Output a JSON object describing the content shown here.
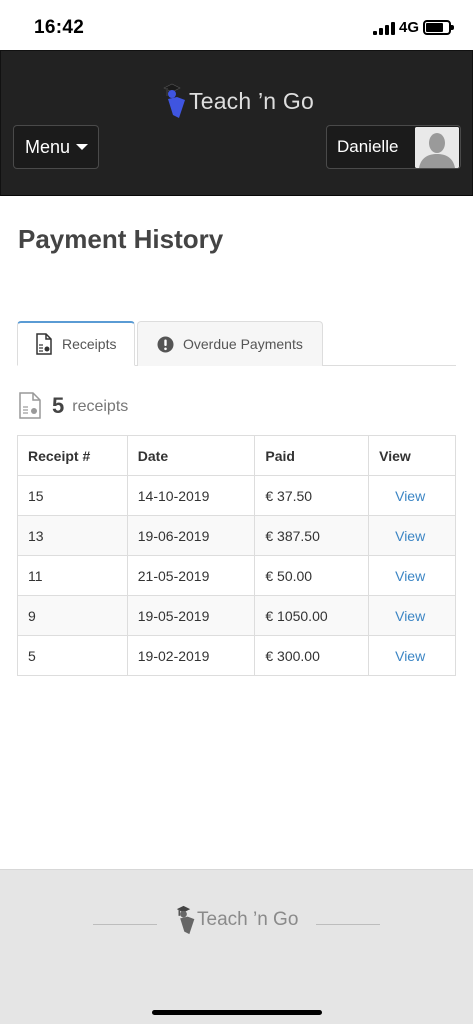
{
  "status_bar": {
    "time": "16:42",
    "network": "4G"
  },
  "header": {
    "app_name": "Teach ’n Go",
    "menu_label": "Menu",
    "user_name": "Danielle"
  },
  "page": {
    "title": "Payment History"
  },
  "tabs": [
    {
      "label": "Receipts",
      "icon": "receipt-icon",
      "active": true
    },
    {
      "label": "Overdue Payments",
      "icon": "alert-icon",
      "active": false
    }
  ],
  "receipts_summary": {
    "count": "5",
    "label": "receipts"
  },
  "table": {
    "columns": [
      "Receipt #",
      "Date",
      "Paid",
      "View"
    ],
    "rows": [
      {
        "receipt": "15",
        "date": "14-10-2019",
        "paid": "€ 37.50",
        "view": "View"
      },
      {
        "receipt": "13",
        "date": "19-06-2019",
        "paid": "€ 387.50",
        "view": "View"
      },
      {
        "receipt": "11",
        "date": "21-05-2019",
        "paid": "€ 50.00",
        "view": "View"
      },
      {
        "receipt": "9",
        "date": "19-05-2019",
        "paid": "€ 1050.00",
        "view": "View"
      },
      {
        "receipt": "5",
        "date": "19-02-2019",
        "paid": "€ 300.00",
        "view": "View"
      }
    ]
  },
  "footer": {
    "brand": "Teach ’n Go"
  },
  "colors": {
    "header_bg": "#222222",
    "link": "#3b85c4",
    "tab_active_border": "#5a9bd4",
    "logo_accent": "#3f55e0",
    "footer_bg": "#e5e5e5"
  }
}
